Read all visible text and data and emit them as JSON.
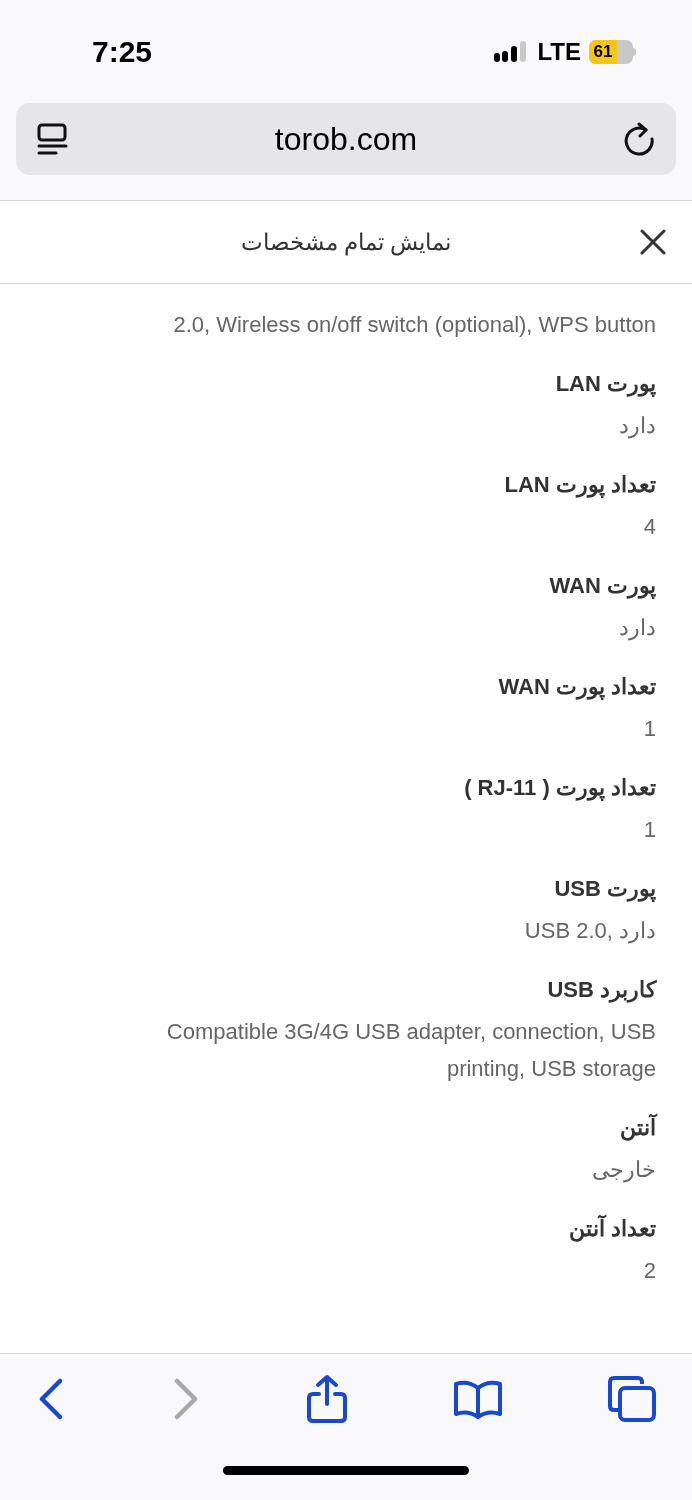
{
  "status_bar": {
    "time": "7:25",
    "network": "LTE",
    "battery": "61"
  },
  "address_bar": {
    "url": "torob.com"
  },
  "sheet": {
    "title": "نمایش تمام مشخصات",
    "continued_value": "2.0, Wireless on/off switch (optional), WPS button",
    "specs": [
      {
        "label": "پورت LAN",
        "value": "دارد"
      },
      {
        "label": "تعداد پورت LAN",
        "value": "4"
      },
      {
        "label": "پورت WAN",
        "value": "دارد"
      },
      {
        "label": "تعداد پورت WAN",
        "value": "1"
      },
      {
        "label": "تعداد پورت ( RJ-11 )",
        "value": "1"
      },
      {
        "label": "پورت USB",
        "value": "USB 2.0, دارد"
      },
      {
        "label": "کاربرد USB",
        "value": "Compatible 3G/4G USB adapter, connection, USB printing, USB storage"
      },
      {
        "label": "آنتن",
        "value": "خارجی"
      },
      {
        "label": "تعداد آنتن",
        "value": "2"
      }
    ]
  },
  "toolbar": {
    "forward_disabled": true
  }
}
